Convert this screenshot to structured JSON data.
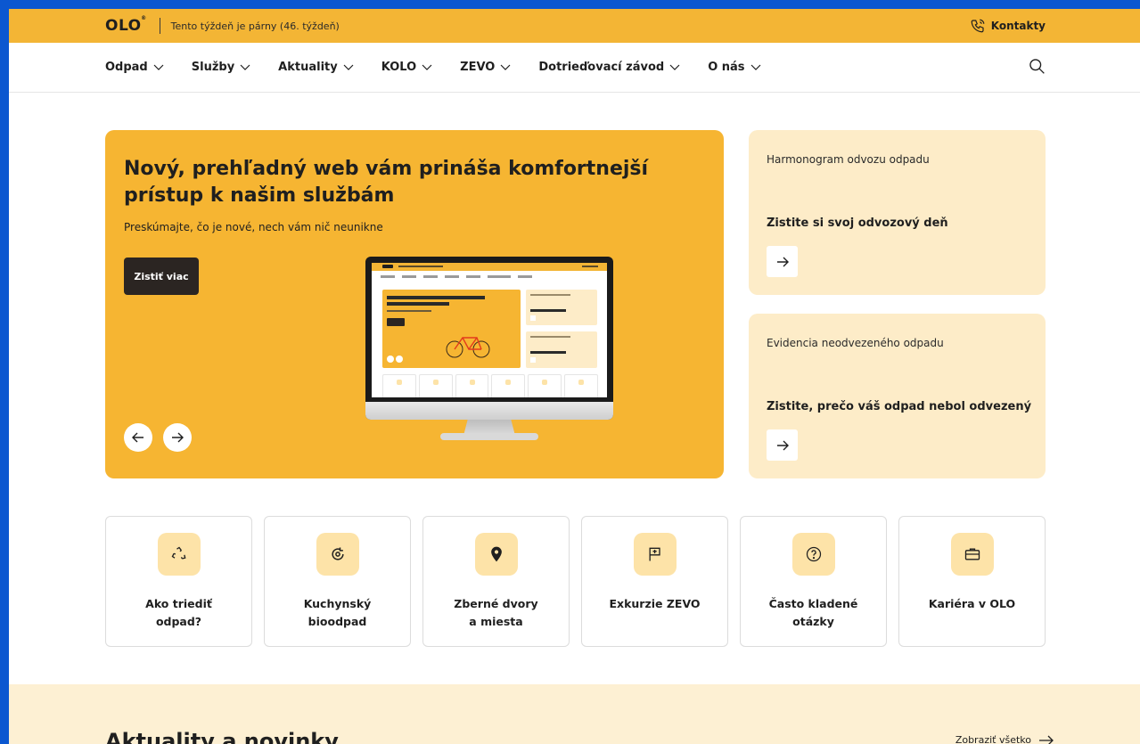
{
  "topbar": {
    "logo": "OLO",
    "logo_mark": "®",
    "week_text": "Tento týždeň je párny (46. týždeň)",
    "contacts_label": "Kontakty",
    "contacts_icon": "phone-icon",
    "color": "#f3b535"
  },
  "nav": {
    "items": [
      {
        "label": "Odpad"
      },
      {
        "label": "Služby"
      },
      {
        "label": "Aktuality"
      },
      {
        "label": "KOLO"
      },
      {
        "label": "ZEVO"
      },
      {
        "label": "Dotrieďovací závod"
      },
      {
        "label": "O nás"
      }
    ],
    "search_icon": "search-icon"
  },
  "hero": {
    "title": "Nový, prehľadný web vám prináša komfortnejší prístup k našim službám",
    "subtitle": "Preskúmajte, čo je nové, nech vám nič neunikne",
    "button_label": "Zistiť viac",
    "prev_icon": "arrow-left-icon",
    "next_icon": "arrow-right-icon",
    "color": "#f6b532"
  },
  "cards": [
    {
      "small": "Harmonogram odvozu odpadu",
      "big": "Zistite si svoj odvozový deň",
      "icon": "arrow-right-icon"
    },
    {
      "small": "Evidencia neodvezeného odpadu",
      "big": "Zistite, prečo váš odpad nebol odvezený",
      "icon": "arrow-right-icon"
    }
  ],
  "tiles": [
    {
      "label": "Ako triediť\nodpad?",
      "icon": "recycle-icon"
    },
    {
      "label": "Kuchynský\nbioodpad",
      "icon": "bio-icon"
    },
    {
      "label": "Zberné dvory\na miesta",
      "icon": "location-pin-icon"
    },
    {
      "label": "Exkurzie ZEVO",
      "icon": "flag-icon"
    },
    {
      "label": "Často kladené\notázky",
      "icon": "question-icon"
    },
    {
      "label": "Kariéra v OLO",
      "icon": "briefcase-icon"
    }
  ],
  "news": {
    "title": "Aktuality a novinky",
    "show_all": "Zobraziť všetko",
    "show_all_icon": "arrow-right-icon"
  }
}
